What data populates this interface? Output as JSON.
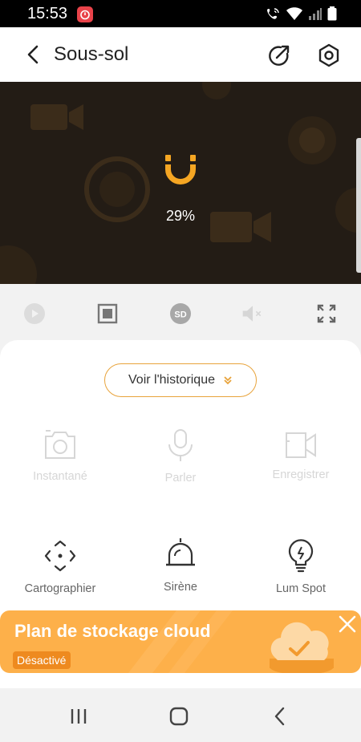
{
  "status_bar": {
    "time": "15:53"
  },
  "header": {
    "title": "Sous-sol",
    "back_icon": "back-arrow-icon",
    "share_icon": "share-icon",
    "settings_icon": "settings-icon"
  },
  "video": {
    "loading_percent": "29%",
    "loading_icon": "brand-logo-icon"
  },
  "controls": [
    {
      "name": "play",
      "icon": "play-icon"
    },
    {
      "name": "stop",
      "icon": "stop-icon"
    },
    {
      "name": "quality",
      "icon": "sd-icon",
      "label": "SD"
    },
    {
      "name": "mute",
      "icon": "mute-icon"
    },
    {
      "name": "fullscreen",
      "icon": "fullscreen-icon"
    }
  ],
  "history_button": {
    "label": "Voir l'historique"
  },
  "features": {
    "snapshot": {
      "label": "Instantané",
      "icon": "camera-icon",
      "enabled": false
    },
    "talk": {
      "label": "Parler",
      "icon": "microphone-icon",
      "enabled": false
    },
    "record": {
      "label": "Enregistrer",
      "icon": "video-record-icon",
      "enabled": false
    },
    "map": {
      "label": "Cartographier",
      "icon": "pan-directions-icon",
      "enabled": true
    },
    "siren": {
      "label": "Sirène",
      "icon": "siren-icon",
      "enabled": true
    },
    "spotlight": {
      "label": "Lum Spot",
      "icon": "lightbulb-icon",
      "enabled": true
    }
  },
  "cloud_banner": {
    "title": "Plan de stockage cloud",
    "status": "Désactivé",
    "close_icon": "close-icon",
    "illustration": "cloud-icon"
  },
  "colors": {
    "accent": "#f5a623",
    "banner": "#fdb04a",
    "video_bg": "#231c15"
  }
}
